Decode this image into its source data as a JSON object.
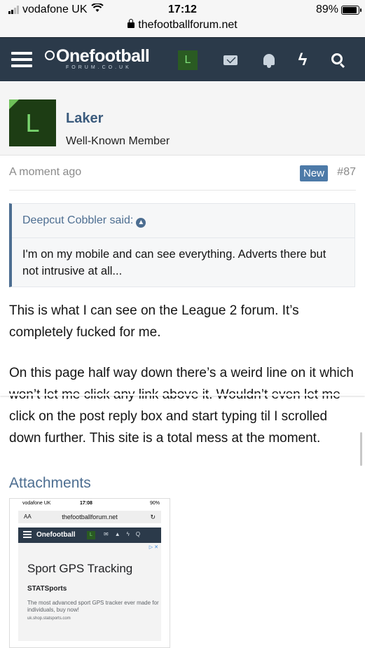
{
  "ios": {
    "carrier": "vodafone UK",
    "time": "17:12",
    "battery": "89%",
    "battery_level": 0.89,
    "url": "thefootballforum.net"
  },
  "nav": {
    "logo_text": "Onefootball",
    "logo_sub": "FORUM.CO.UK",
    "avatar_letter": "L",
    "bolt_glyph": "ϟ"
  },
  "post": {
    "user": {
      "avatar_letter": "L",
      "name": "Laker",
      "title": "Well-Known Member"
    },
    "time": "A moment ago",
    "new_badge": "New",
    "post_number": "#87",
    "quote": {
      "author": "Deepcut Cobbler said:",
      "text": "I'm on my mobile and can see everything. Adverts there but not intrusive at all..."
    },
    "paragraphs": [
      "This is what I can see on the League 2 forum. It’s completely fucked for me.",
      "On this page half way down there’s a weird line on it which won’t let me click any link above it. Wouldn’t even let me click on the post reply box and start typing til I scrolled down further. This site is a total mess at the moment."
    ],
    "attachments_title": "Attachments"
  },
  "attachment_preview": {
    "carrier": "vodafone UK",
    "time": "17:08",
    "battery": "90%",
    "url_aa": "AA",
    "url": "thefootballforum.net",
    "logo": "Onefootball",
    "avatar": "L",
    "ad_marker": "▷ ✕",
    "ad_title": "Sport GPS Tracking",
    "ad_brand": "STATSports",
    "ad_desc": "The most advanced sport GPS tracker ever made for individuals, buy now!",
    "ad_url": "uk.shop.statsports.com"
  },
  "colors": {
    "nav_bg": "#2b3a4a",
    "link": "#4d6e91",
    "new_badge": "#4d7aa8",
    "avatar_bg": "#1d3d14"
  }
}
